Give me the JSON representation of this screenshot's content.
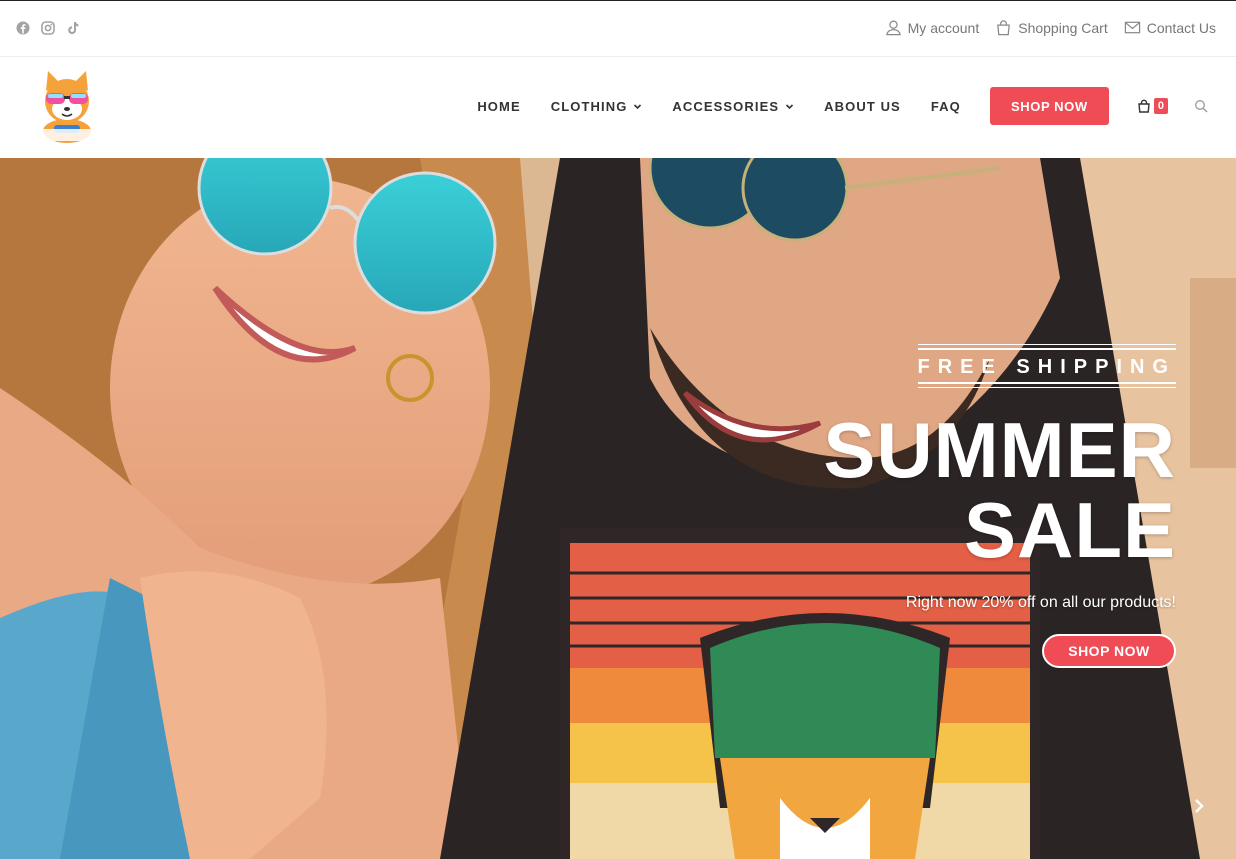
{
  "topbar": {
    "social": [
      "facebook-icon",
      "instagram-icon",
      "tiktok-icon"
    ],
    "links": [
      {
        "label": "My account",
        "icon": "user-icon"
      },
      {
        "label": "Shopping Cart",
        "icon": "bag-icon"
      },
      {
        "label": "Contact Us",
        "icon": "mail-icon"
      }
    ]
  },
  "header": {
    "nav": {
      "home": "HOME",
      "clothing": "CLOTHING",
      "accessories": "ACCESSORIES",
      "about": "ABOUT US",
      "faq": "FAQ",
      "shop_now": "SHOP NOW"
    },
    "cart_count": "0"
  },
  "hero": {
    "kicker": "FREE SHIPPING",
    "title_line1": "SUMMER",
    "title_line2": "SALE",
    "subtitle": "Right now 20% off on all our products!",
    "button": "SHOP NOW"
  },
  "colors": {
    "accent": "#f04c55",
    "text": "#333333",
    "muted": "#777777"
  }
}
